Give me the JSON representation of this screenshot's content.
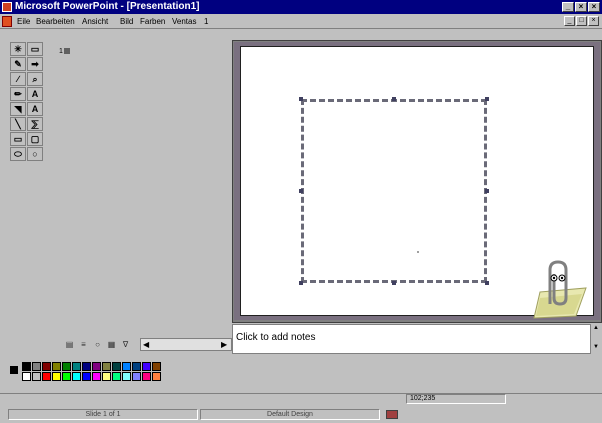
{
  "window": {
    "title": "Microsoft PowerPoint - [Presentation1]",
    "controls": {
      "minimize": "_",
      "restore": "×",
      "close": "×"
    }
  },
  "menu": {
    "items": [
      "Eile",
      "Bearbeiten",
      "Ansicht",
      "Bild",
      "Farben",
      "Ventas",
      "1"
    ],
    "controls": {
      "minimize": "_",
      "restore": "□",
      "close": "×"
    }
  },
  "drawing_toolbar": {
    "tools": [
      {
        "icon": "pointer-icon",
        "glyph": "✳"
      },
      {
        "icon": "rectangle-tool-icon",
        "glyph": "▭"
      },
      {
        "icon": "pencil-icon",
        "glyph": "✎"
      },
      {
        "icon": "arrow-right-icon",
        "glyph": "➡"
      },
      {
        "icon": "line-tool-icon",
        "glyph": "∕"
      },
      {
        "icon": "zoom-icon",
        "glyph": "⌕"
      },
      {
        "icon": "fill-icon",
        "glyph": "✏"
      },
      {
        "icon": "shadow-text-icon",
        "glyph": "A"
      },
      {
        "icon": "color-picker-icon",
        "glyph": "◥"
      },
      {
        "icon": "text-tool-icon",
        "glyph": "A"
      },
      {
        "icon": "diagonal-line-icon",
        "glyph": "╲"
      },
      {
        "icon": "curve-tool-icon",
        "glyph": "⅀"
      },
      {
        "icon": "rectangle-shape-icon",
        "glyph": "▭"
      },
      {
        "icon": "rounded-rect-icon",
        "glyph": "▢"
      },
      {
        "icon": "ellipse-icon",
        "glyph": "⬭"
      },
      {
        "icon": "circle-icon",
        "glyph": "○"
      }
    ]
  },
  "outline": {
    "slide_number": "1"
  },
  "view_buttons": [
    {
      "icon": "normal-view-icon",
      "glyph": "▤"
    },
    {
      "icon": "outline-view-icon",
      "glyph": "≡"
    },
    {
      "icon": "slide-view-icon",
      "glyph": "○"
    },
    {
      "icon": "sorter-view-icon",
      "glyph": "▦"
    },
    {
      "icon": "show-view-icon",
      "glyph": "∇"
    }
  ],
  "notes": {
    "placeholder": "Click to add notes"
  },
  "palette": {
    "row1": [
      "#000000",
      "#808080",
      "#800000",
      "#808000",
      "#008000",
      "#008080",
      "#000080",
      "#800080",
      "#808040",
      "#004040",
      "#0080ff",
      "#004080",
      "#4000ff",
      "#804000"
    ],
    "row2": [
      "#ffffff",
      "#c0c0c0",
      "#ff0000",
      "#ffff00",
      "#00ff00",
      "#00ffff",
      "#0000ff",
      "#ff00ff",
      "#ffff80",
      "#00ff80",
      "#80ffff",
      "#8080ff",
      "#ff0080",
      "#ff8040"
    ]
  },
  "status": {
    "coordinates": "102;235",
    "slide": "Slide 1 of 1",
    "design": "Default Design"
  }
}
